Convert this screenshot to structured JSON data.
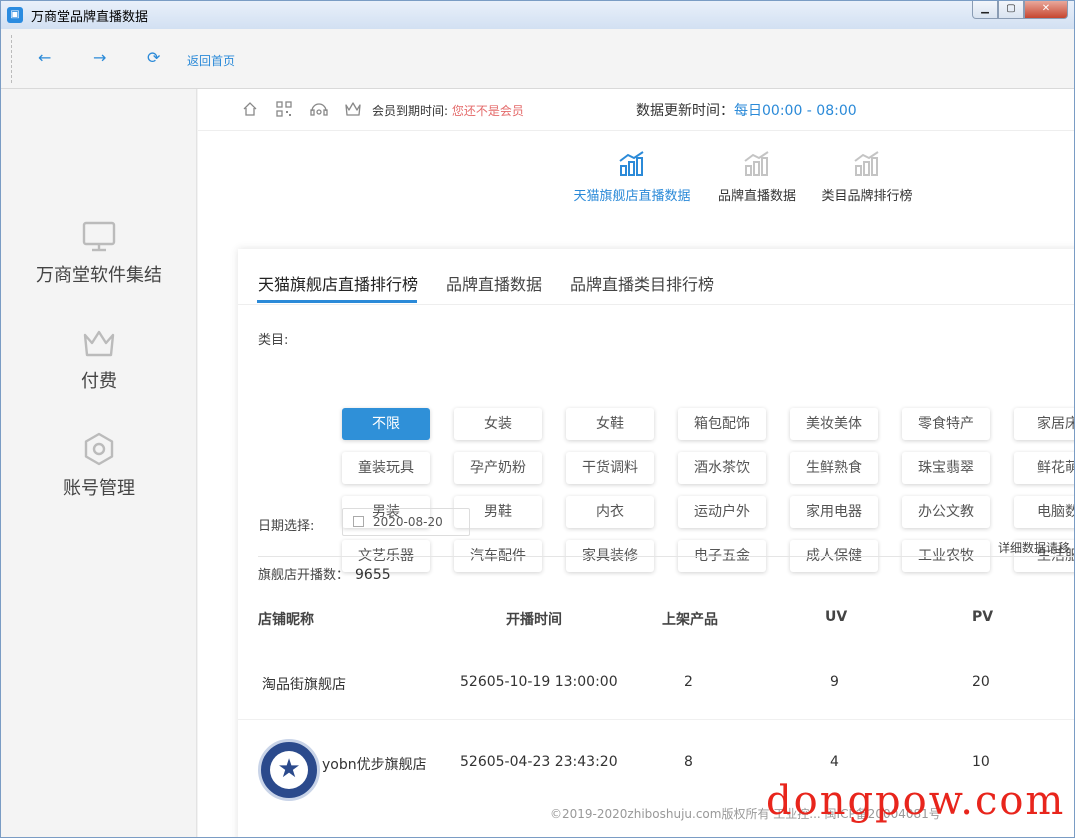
{
  "window": {
    "title": "万商堂品牌直播数据",
    "controls": {
      "minimize": "▁",
      "maximize": "▢",
      "close": "✕"
    }
  },
  "toolbar": {
    "back_icon": "←",
    "forward_icon": "→",
    "refresh_icon": "⟳",
    "home_label": "返回首页"
  },
  "sidebar": {
    "items": [
      {
        "label": "万商堂软件集结",
        "icon": "monitor-icon"
      },
      {
        "label": "付费",
        "icon": "crown-icon"
      },
      {
        "label": "账号管理",
        "icon": "hexagon-icon"
      }
    ]
  },
  "info_bar": {
    "member_label": "会员到期时间:",
    "member_status": "您还不是会员",
    "update_label": "数据更新时间：",
    "update_value": "每日00:00 - 08:00"
  },
  "top_tabs": [
    {
      "label": "天猫旗舰店直播数据",
      "active": true
    },
    {
      "label": "品牌直播数据",
      "active": false
    },
    {
      "label": "类目品牌排行榜",
      "active": false
    }
  ],
  "sub_tabs": [
    {
      "label": "天猫旗舰店直播排行榜",
      "active": true
    },
    {
      "label": "品牌直播数据",
      "active": false
    },
    {
      "label": "品牌直播类目排行榜",
      "active": false
    }
  ],
  "categories": {
    "label": "类目:",
    "rows": [
      [
        "不限",
        "女装",
        "女鞋",
        "箱包配饰",
        "美妆美体",
        "零食特产",
        "家居床"
      ],
      [
        "童装玩具",
        "孕产奶粉",
        "干货调料",
        "酒水茶饮",
        "生鲜熟食",
        "珠宝翡翠",
        "鲜花萌"
      ],
      [
        "男装",
        "男鞋",
        "内衣",
        "运动户外",
        "家用电器",
        "办公文教",
        "电脑数"
      ],
      [
        "文艺乐器",
        "汽车配件",
        "家具装修",
        "电子五金",
        "成人保健",
        "工业农牧",
        "生活服"
      ]
    ],
    "selected": "不限"
  },
  "date": {
    "label": "日期选择:",
    "value": "2020-08-20"
  },
  "detail_link": "详细数据请移",
  "store_count": {
    "label": "旗舰店开播数：",
    "value": "9655"
  },
  "table": {
    "headers": [
      "店铺昵称",
      "开播时间",
      "上架产品",
      "UV",
      "PV"
    ],
    "rows": [
      [
        "淘品街旗舰店",
        "52605-10-19 13:00:00",
        "2",
        "9",
        "20"
      ],
      [
        "yobn优步旗舰店",
        "52605-04-23 23:43:20",
        "8",
        "4",
        "10"
      ]
    ]
  },
  "footer": {
    "copyright": "©2019-2020zhiboshuju.com版权所有 工业控... 闽ICP备20004081号"
  },
  "watermark": "dongpow.com",
  "colors": {
    "accent": "#2b8ad8",
    "active_button": "#2f90d8",
    "warning": "#e46a6a",
    "watermark": "#e8251c"
  }
}
